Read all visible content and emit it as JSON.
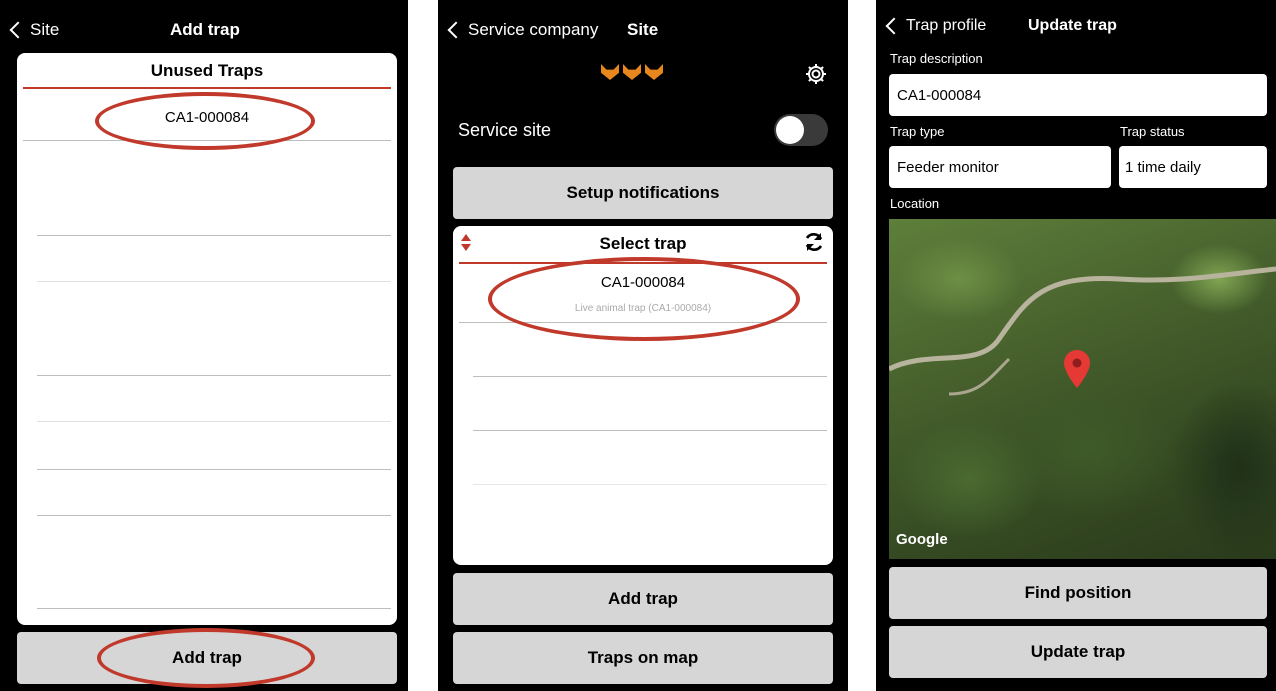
{
  "screen1": {
    "back_label": "Site",
    "title": "Add trap",
    "list_header": "Unused Traps",
    "items": [
      "CA1-000084"
    ],
    "add_button": "Add trap"
  },
  "screen2": {
    "back_label": "Service company",
    "title": "Site",
    "service_site_label": "Service site",
    "setup_button": "Setup notifications",
    "select_header": "Select trap",
    "trap_name": "CA1-000084",
    "trap_sub": "Live animal trap (CA1-000084)",
    "add_button": "Add trap",
    "map_button": "Traps on map"
  },
  "screen3": {
    "back_label": "Trap profile",
    "title": "Update trap",
    "desc_label": "Trap description",
    "desc_value": "CA1-000084",
    "type_label": "Trap type",
    "type_value": "Feeder monitor",
    "status_label": "Trap status",
    "status_value": "1 time daily",
    "location_label": "Location",
    "map_logo": "Google",
    "find_button": "Find position",
    "update_button": "Update trap"
  },
  "colors": {
    "accent": "#c0392b",
    "button": "#d6d6d6"
  }
}
